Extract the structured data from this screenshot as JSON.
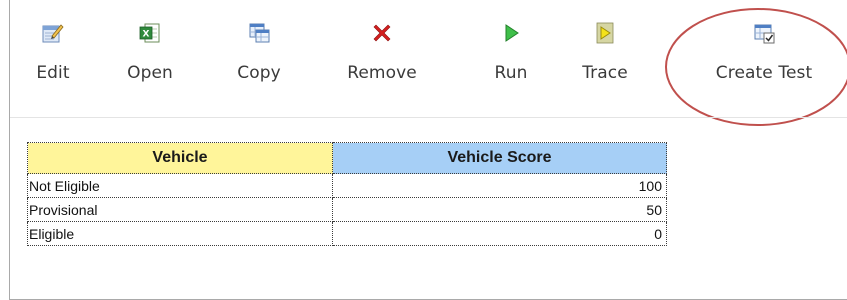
{
  "toolbar": {
    "items": [
      {
        "label": "Edit",
        "icon": "edit-icon"
      },
      {
        "label": "Open",
        "icon": "excel-icon"
      },
      {
        "label": "Copy",
        "icon": "copy-table-icon"
      },
      {
        "label": "Remove",
        "icon": "remove-x-icon"
      },
      {
        "label": "Run",
        "icon": "run-play-icon"
      },
      {
        "label": "Trace",
        "icon": "trace-icon"
      },
      {
        "label": "Create Test",
        "icon": "create-test-icon"
      }
    ]
  },
  "table": {
    "headers": [
      "Vehicle",
      "Vehicle Score"
    ],
    "rows": [
      {
        "name": "Not Eligible",
        "score": "100"
      },
      {
        "name": "Provisional",
        "score": "50"
      },
      {
        "name": "Eligible",
        "score": "0"
      }
    ]
  },
  "colors": {
    "header_vehicle": "#fff59a",
    "header_score": "#a6cff6",
    "highlight": "#c0504d"
  }
}
